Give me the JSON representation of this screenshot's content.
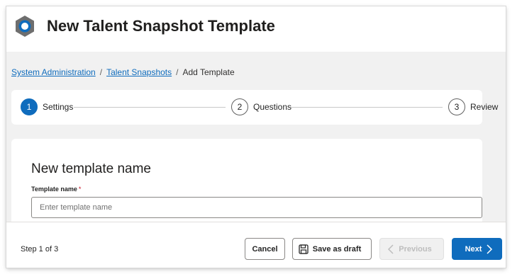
{
  "header": {
    "title": "New Talent Snapshot Template",
    "icon": "gear-icon",
    "icon_color": "#0f6cbd"
  },
  "breadcrumb": {
    "items": [
      "System Administration",
      "Talent Snapshots"
    ],
    "separator": "/",
    "current": "Add Template"
  },
  "stepper": {
    "steps": [
      {
        "number": "1",
        "label": "Settings",
        "state": "active"
      },
      {
        "number": "2",
        "label": "Questions",
        "state": "pending"
      },
      {
        "number": "3",
        "label": "Review",
        "state": "pending"
      }
    ]
  },
  "form": {
    "heading": "New template name",
    "field_label": "Template name",
    "required_marker": "*",
    "placeholder": "Enter template name",
    "value": ""
  },
  "footer": {
    "step_text": "Step 1 of 3",
    "cancel_label": "Cancel",
    "save_draft_label": "Save as draft",
    "previous_label": "Previous",
    "next_label": "Next",
    "previous_disabled": true
  },
  "colors": {
    "accent": "#0f6cbd",
    "page_background": "#f1f1f1",
    "required": "#c50f1f"
  }
}
